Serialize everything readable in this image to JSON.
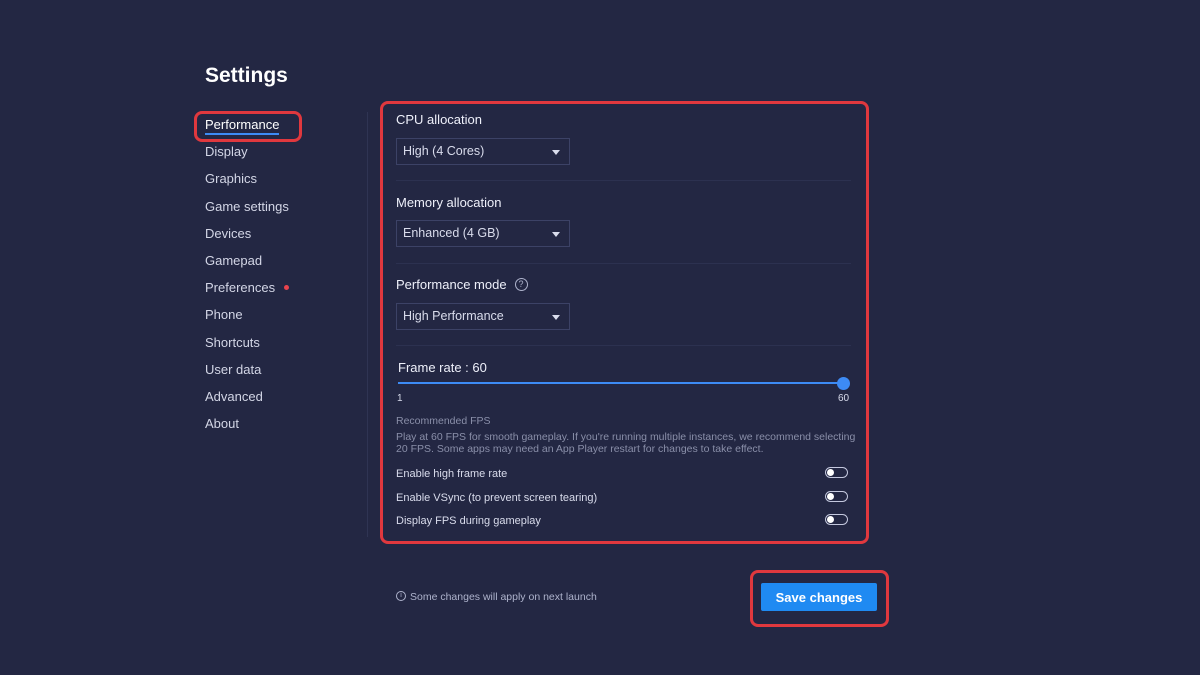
{
  "page": {
    "title": "Settings"
  },
  "sidebar": {
    "items": [
      {
        "label": "Performance"
      },
      {
        "label": "Display"
      },
      {
        "label": "Graphics"
      },
      {
        "label": "Game settings"
      },
      {
        "label": "Devices"
      },
      {
        "label": "Gamepad"
      },
      {
        "label": "Preferences"
      },
      {
        "label": "Phone"
      },
      {
        "label": "Shortcuts"
      },
      {
        "label": "User data"
      },
      {
        "label": "Advanced"
      },
      {
        "label": "About"
      }
    ]
  },
  "performance": {
    "cpu": {
      "label": "CPU allocation",
      "value": "High (4 Cores)"
    },
    "memory": {
      "label": "Memory allocation",
      "value": "Enhanced (4 GB)"
    },
    "mode": {
      "label": "Performance mode",
      "help": "?",
      "value": "High Performance"
    },
    "frame_rate": {
      "label": "Frame rate : 60",
      "min_label": "1",
      "max_label": "60",
      "value": 60,
      "min": 1,
      "max": 60
    },
    "recommended": {
      "title": "Recommended FPS",
      "text": "Play at 60 FPS for smooth gameplay. If you're running multiple instances, we recommend selecting 20 FPS. Some apps may need an App Player restart for changes to take effect."
    },
    "toggles": [
      {
        "label": "Enable high frame rate",
        "on": false
      },
      {
        "label": "Enable VSync (to prevent screen tearing)",
        "on": false
      },
      {
        "label": "Display FPS during gameplay",
        "on": false
      }
    ]
  },
  "footer": {
    "note_icon": "i",
    "note": "Some changes will apply on next launch",
    "save_label": "Save changes"
  },
  "colors": {
    "background": "#232743",
    "accent": "#1f8af2",
    "highlight": "#e0383e",
    "notification_dot": "#e8434d"
  },
  "icons": {
    "dropdown": "chevron-down-icon",
    "help": "help-circle-icon",
    "info": "info-circle-icon",
    "notification": "notification-dot-icon"
  }
}
